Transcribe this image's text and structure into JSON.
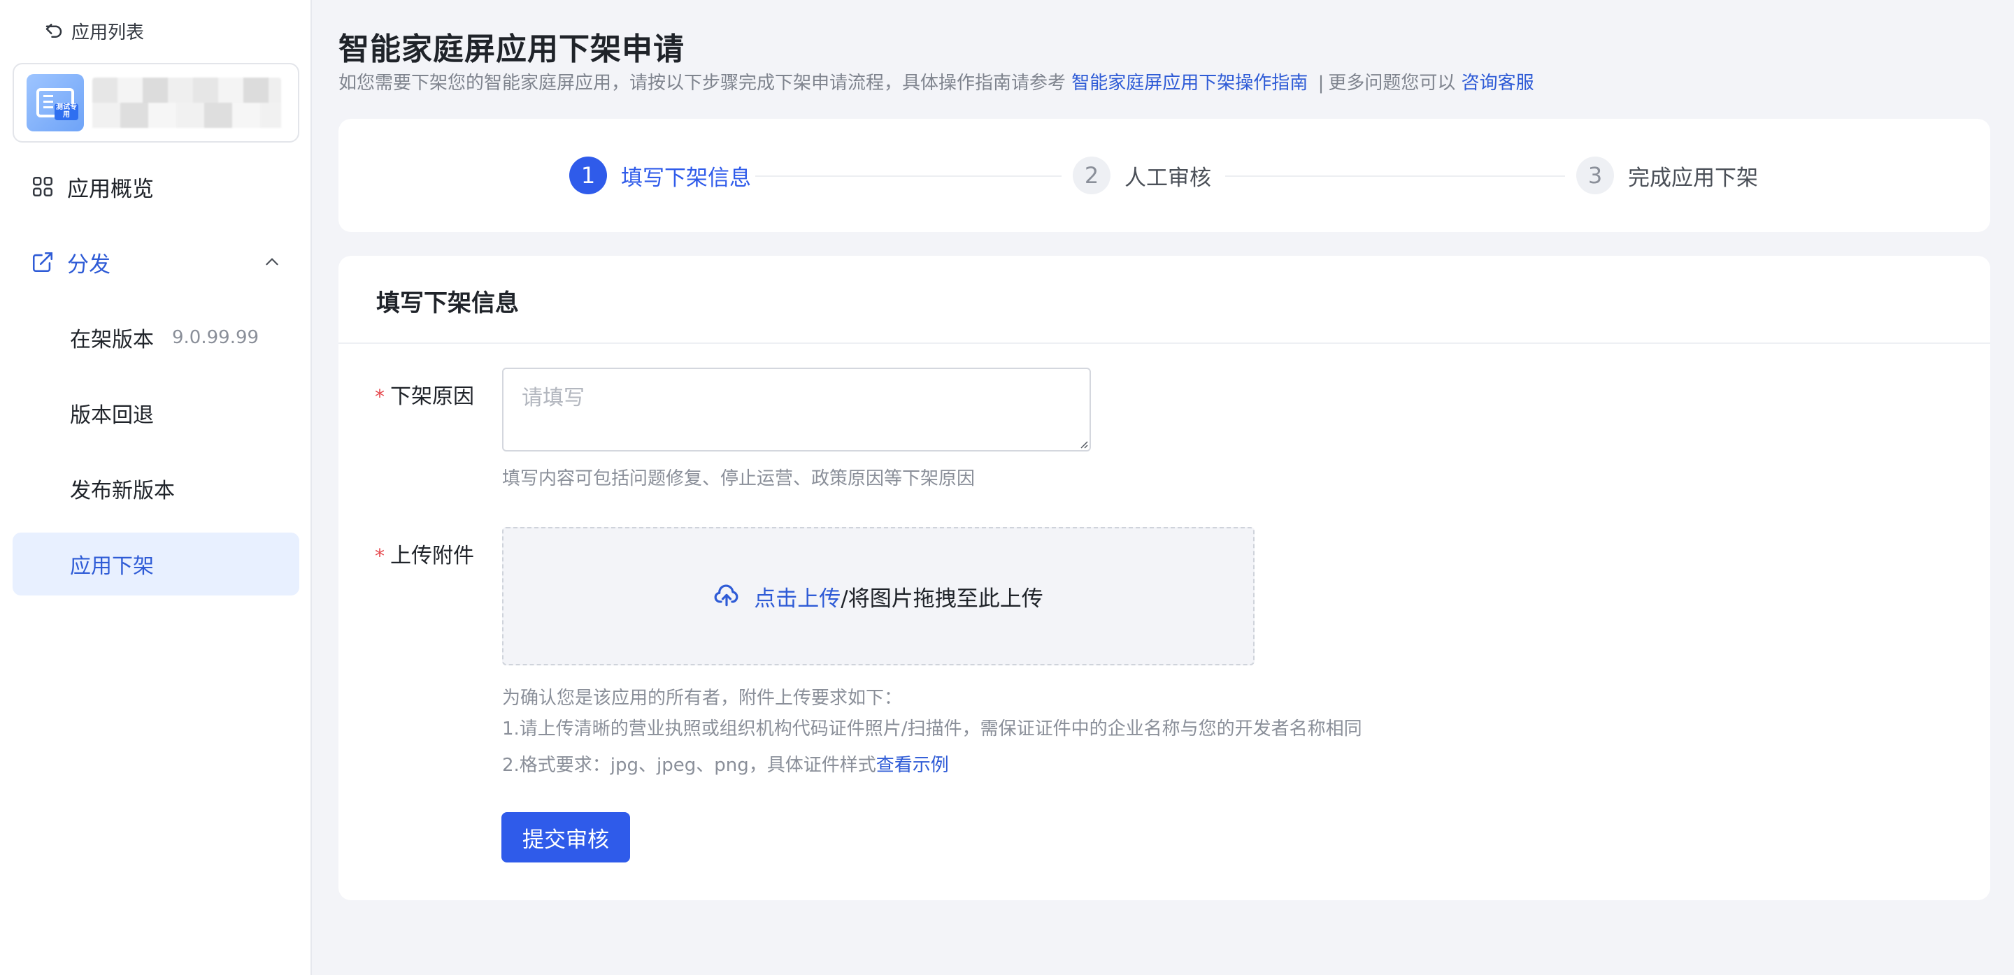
{
  "sidebar": {
    "back_label": "应用列表",
    "app_card": {
      "icon_tag": "测试专用",
      "name": ""
    },
    "items": [
      {
        "label": "应用概览",
        "icon": "grid-icon"
      },
      {
        "label": "分发",
        "icon": "external-link-icon",
        "expanded": true
      }
    ],
    "sub_items": [
      {
        "label": "在架版本",
        "version": "9.0.99.99"
      },
      {
        "label": "版本回退"
      },
      {
        "label": "发布新版本"
      },
      {
        "label": "应用下架",
        "active": true
      }
    ]
  },
  "header": {
    "title": "智能家庭屏应用下架申请",
    "subtitle_prefix": "如您需要下架您的智能家庭屏应用，请按以下步骤完成下架申请流程，具体操作指南请参考",
    "guide_link": "智能家庭屏应用下架操作指南",
    "separator": "|",
    "subtitle_mid": "更多问题您可以",
    "support_link": "咨询客服"
  },
  "steps": [
    {
      "num": "1",
      "label": "填写下架信息",
      "state": "active"
    },
    {
      "num": "2",
      "label": "人工审核",
      "state": "inactive"
    },
    {
      "num": "3",
      "label": "完成应用下架",
      "state": "inactive"
    }
  ],
  "form": {
    "title": "填写下架信息",
    "required_mark": "*",
    "reason": {
      "label": "下架原因",
      "placeholder": "请填写",
      "value": "",
      "hint": "填写内容可包括问题修复、停止运营、政策原因等下架原因"
    },
    "attachment": {
      "label": "上传附件",
      "upload_link": "点击上传",
      "upload_rest": "/将图片拖拽至此上传",
      "requirements_title": "为确认您是该应用的所有者，附件上传要求如下：",
      "requirement_1": "1.请上传清晰的营业执照或组织机构代码证件照片/扫描件，需保证证件中的企业名称与您的开发者名称相同",
      "requirement_2_prefix": "2.格式要求：jpg、jpeg、png，具体证件样式",
      "example_link": "查看示例"
    },
    "submit_label": "提交审核"
  },
  "colors": {
    "primary": "#2f5bea",
    "link": "#2e5bd6",
    "required": "#e5484d",
    "active_bg": "#e8f0ff",
    "page_bg": "#f3f4f8"
  }
}
